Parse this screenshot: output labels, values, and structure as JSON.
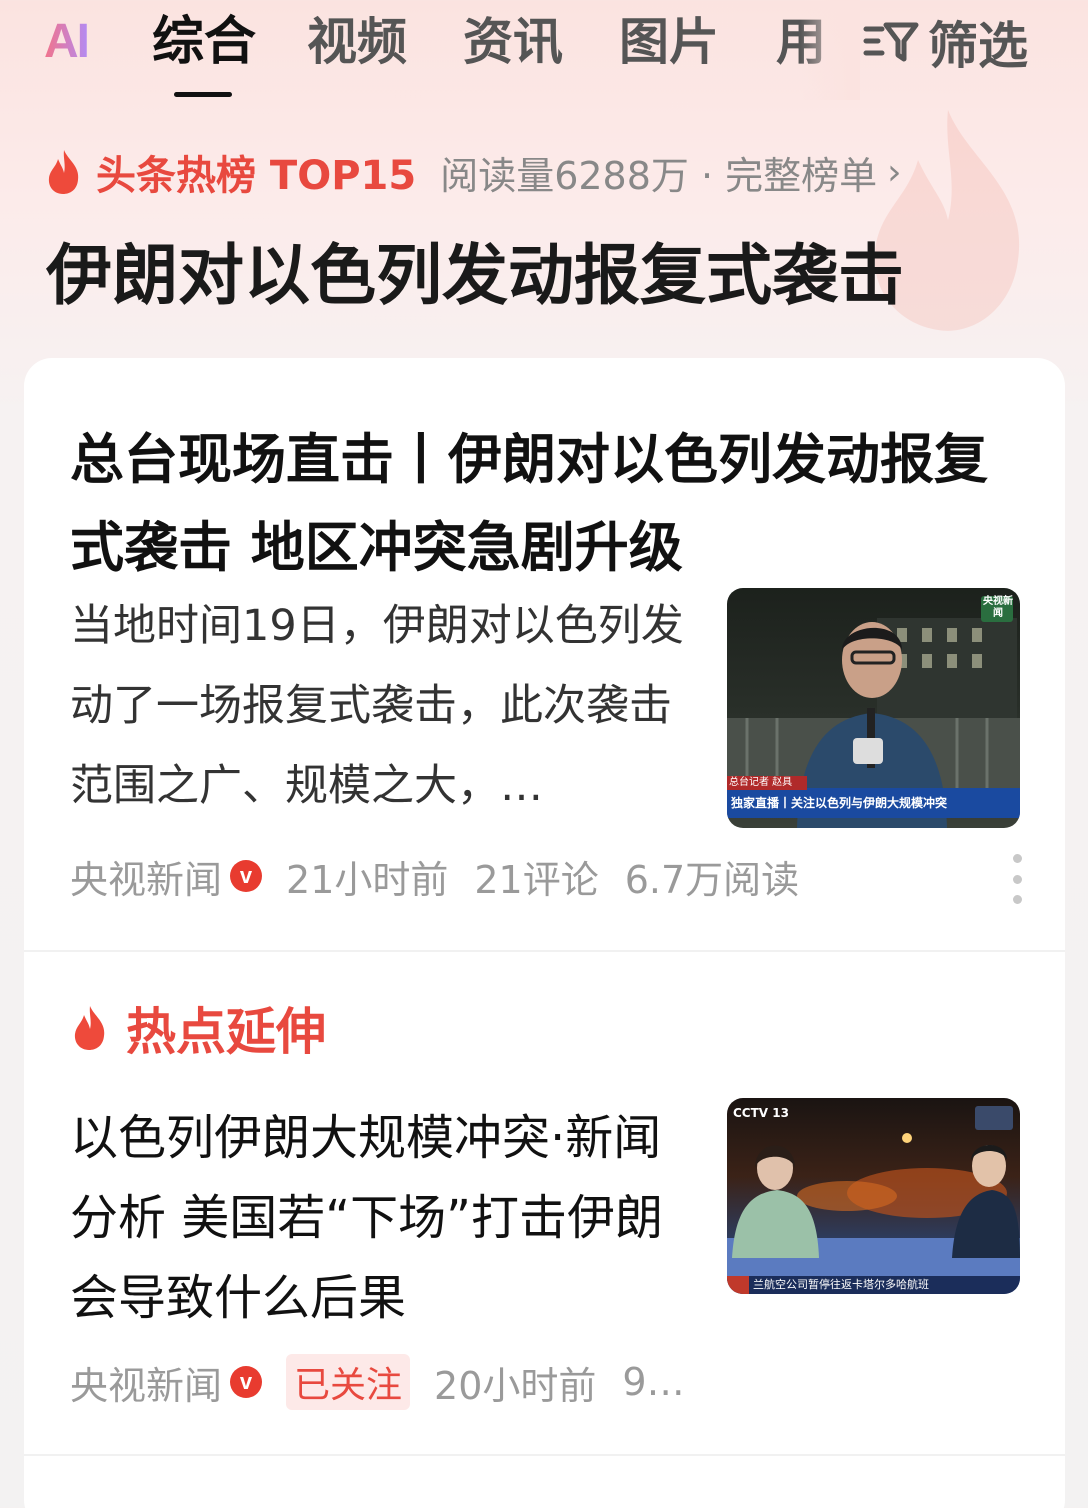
{
  "tabs": {
    "ai": "AI",
    "items": [
      "综合",
      "视频",
      "资讯",
      "图片",
      "用"
    ],
    "active_index": 0,
    "filter_label": "筛选"
  },
  "hot_list": {
    "label": "头条热榜 TOP15",
    "meta": "阅读量6288万 · 完整榜单",
    "headline": "伊朗对以色列发动报复式袭击"
  },
  "article1": {
    "title": "总台现场直击丨伊朗对以色列发动报复式袭击 地区冲突急剧升级",
    "summary": "当地时间19日，伊朗对以色列发动了一场报复式袭击，此次袭击范围之广、规模之大，…",
    "thumb_logo": "央视新闻",
    "thumb_caption_top": "总台记者 赵具",
    "thumb_caption": "独家直播丨关注以色列与伊朗大规模冲突",
    "source": "央视新闻",
    "verified": "v",
    "time": "21小时前",
    "comments": "21评论",
    "reads": "6.7万阅读"
  },
  "section": {
    "title": "热点延伸"
  },
  "article2": {
    "title": "以色列伊朗大规模冲突·新闻分析 美国若“下场”打击伊朗会导致什么后果",
    "thumb_logo": "CCTV 13",
    "thumb_ticker": "兰航空公司暂停往返卡塔尔多哈航班",
    "source": "央视新闻",
    "verified": "v",
    "follow": "已关注",
    "time": "20小时前",
    "extra": "9…"
  },
  "colors": {
    "accent": "#e8493f",
    "verified_badge": "#e83b2f",
    "muted": "#9a9a9a"
  },
  "icons": [
    "flame-icon",
    "filter-icon",
    "chevron-right-icon",
    "more-icon"
  ]
}
